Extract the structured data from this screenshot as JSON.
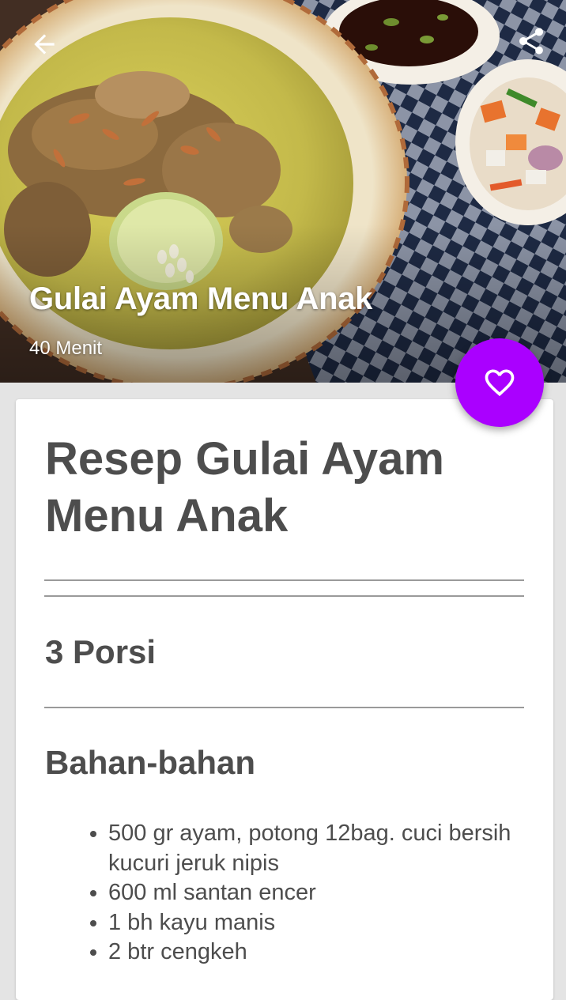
{
  "header": {
    "title": "Gulai Ayam Menu Anak",
    "duration": "40 Menit",
    "back_icon": "arrow-left-icon",
    "share_icon": "share-icon"
  },
  "favorite": {
    "icon": "heart-outline-icon",
    "color": "#aa00ff"
  },
  "recipe": {
    "title": "Resep Gulai Ayam Menu Anak",
    "portions": "3 Porsi",
    "ingredients_heading": "Bahan-bahan",
    "ingredients": [
      "500 gr ayam, potong 12bag. cuci bersih kucuri jeruk nipis",
      "600 ml santan encer",
      "1 bh kayu manis",
      "2 btr cengkeh"
    ]
  }
}
